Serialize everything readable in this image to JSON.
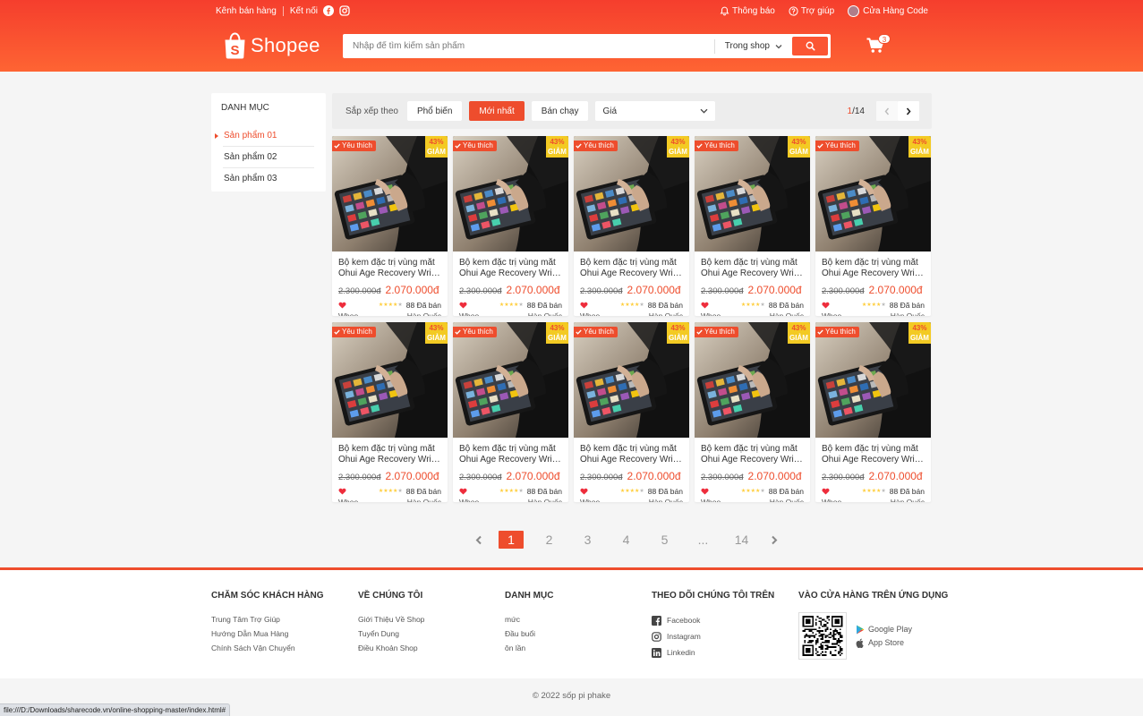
{
  "topbar": {
    "seller_channel": "Kênh bán hàng",
    "connect": "Kết nối",
    "notifications": "Thông báo",
    "help": "Trợ giúp",
    "user_name": "Cửa Hàng Code"
  },
  "brand": {
    "name": "Shopee",
    "color": "#ee4d2d"
  },
  "search": {
    "placeholder": "Nhập để tìm kiếm sản phẩm",
    "scope": "Trong shop"
  },
  "cart": {
    "count": "3"
  },
  "sidebar": {
    "title": "DANH MỤC",
    "items": [
      {
        "label": "Sản phẩm 01",
        "active": true
      },
      {
        "label": "Sản phẩm 02",
        "active": false
      },
      {
        "label": "Sản phẩm 03",
        "active": false
      }
    ]
  },
  "sortbar": {
    "label": "Sắp xếp theo",
    "options": [
      "Phổ biến",
      "Mới nhất",
      "Bán chạy"
    ],
    "active_index": 1,
    "price_select": "Giá",
    "page_current": "1",
    "page_total": "/14"
  },
  "product_template": {
    "favorite": "Yêu thích",
    "discount_pct": "43%",
    "discount_word": "GIẢM",
    "name_line1": "Bộ kem đặc trị vùng mắt",
    "name_line2": "Ohui Age Recovery Wrinkle Eye Cream",
    "old_price": "2.300.000đ",
    "new_price": "2.070.000đ",
    "rating": 4,
    "sold": "88 Đã bán",
    "brand": "Whoo",
    "origin": "Hàn Quốc"
  },
  "product_count": 10,
  "pagination": {
    "pages": [
      "1",
      "2",
      "3",
      "4",
      "5",
      "...",
      "14"
    ],
    "active_index": 0
  },
  "footer": {
    "columns": [
      {
        "title": "CHĂM SÓC KHÁCH HÀNG",
        "links": [
          "Trung Tâm Trợ Giúp",
          "Hướng Dẫn Mua Hàng",
          "Chính Sách Vận Chuyển"
        ]
      },
      {
        "title": "VỀ CHÚNG TÔI",
        "links": [
          "Giới Thiệu Về Shop",
          "Tuyển Dụng",
          "Điều Khoản Shop"
        ]
      },
      {
        "title": "DANH MỤC",
        "links": [
          "mức",
          "Đầu buổi",
          "ôn lần"
        ]
      }
    ],
    "social": {
      "title": "THEO DÕI CHÚNG TÔI TRÊN",
      "links": [
        "Facebook",
        "Instagram",
        "Linkedin"
      ]
    },
    "app": {
      "title": "VÀO CỬA HÀNG TRÊN ỨNG DỤNG",
      "stores": [
        "Google Play",
        "App Store"
      ]
    }
  },
  "copyright": "© 2022 sốp pi phake",
  "status_url": "file:///D:/Downloads/sharecode.vn/online-shopping-master/index.html#"
}
